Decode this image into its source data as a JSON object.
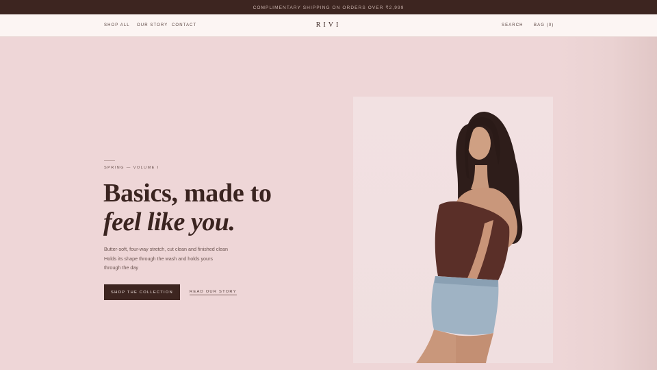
{
  "announcement": "COMPLIMENTARY SHIPPING ON ORDERS OVER ₹2,999",
  "nav": {
    "left_links": [
      "SHOP ALL",
      "OUR STORY",
      "CONTACT"
    ],
    "brand": "RIVI",
    "search": "SEARCH",
    "bag": "BAG (0)"
  },
  "hero": {
    "eyebrow": "SPRING — VOLUME I",
    "headline_line1": "Basics, made to",
    "headline_line2": "feel like you.",
    "body_lines": [
      "Butter-soft, four-way stretch, cut clean and finished clean",
      "Holds its shape through the wash and holds yours",
      "through the day"
    ],
    "primary_cta": "SHOP THE COLLECTION",
    "secondary_cta": "READ OUR STORY"
  },
  "colors": {
    "accent": "#3d2520",
    "background": "#eed6d7",
    "nav_background": "#fcf5f3",
    "photo_background": "#f2e1e2"
  }
}
